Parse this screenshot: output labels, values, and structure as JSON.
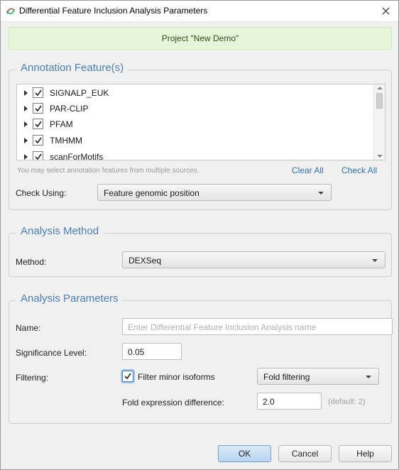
{
  "window": {
    "title": "Differential Feature Inclusion Analysis Parameters"
  },
  "banner": {
    "text": "Project \"New Demo\""
  },
  "annotation": {
    "legend": "Annotation Feature(s)",
    "items": [
      {
        "label": "SIGNALP_EUK",
        "checked": true
      },
      {
        "label": "PAR-CLIP",
        "checked": true
      },
      {
        "label": "PFAM",
        "checked": true
      },
      {
        "label": "TMHMM",
        "checked": true
      },
      {
        "label": "scanForMotifs",
        "checked": true
      }
    ],
    "hint": "You may select annotation features from multiple sources.",
    "clear_all": "Clear All",
    "check_all": "Check All",
    "check_using_label": "Check Using:",
    "check_using_value": "Feature genomic position"
  },
  "method": {
    "legend": "Analysis Method",
    "label": "Method:",
    "value": "DEXSeq"
  },
  "params": {
    "legend": "Analysis Parameters",
    "name_label": "Name:",
    "name_placeholder": "Enter Differential Feature Inclusion Analysis name",
    "significance_label": "Significance Level:",
    "significance_value": "0.05",
    "filtering_label": "Filtering:",
    "filter_minor_label": "Filter minor isoforms",
    "filter_minor_checked": true,
    "fold_filtering_value": "Fold filtering",
    "fold_expr_label": "Fold expression difference:",
    "fold_expr_value": "2.0",
    "fold_expr_default": "(default: 2)"
  },
  "buttons": {
    "ok": "OK",
    "cancel": "Cancel",
    "help": "Help"
  },
  "colors": {
    "accent": "#4a7fb5",
    "banner_bg": "#e6f7d9",
    "link": "#2f6fb3"
  }
}
